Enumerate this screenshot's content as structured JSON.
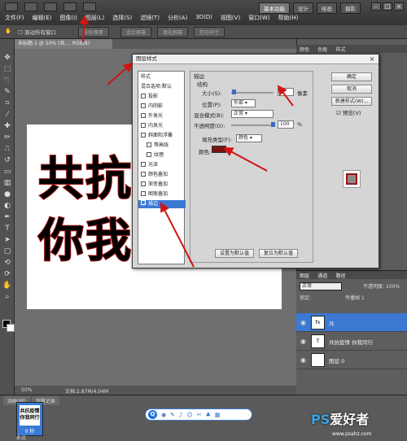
{
  "menubar": {
    "items": [
      "文件(F)",
      "编辑(E)",
      "图像(I)",
      "图层(L)",
      "选择(S)",
      "滤镜(T)",
      "分析(A)",
      "3D(D)",
      "视图(V)",
      "窗口(W)",
      "帮助(H)"
    ],
    "workspaces": [
      "基本功能",
      "设计",
      "绘画",
      "摄影"
    ]
  },
  "optionsbar": {
    "scroll_all": "滚动所有窗口",
    "btn_actual": "实际像素",
    "btn_fit": "适合屏幕",
    "btn_fill": "填充屏幕",
    "btn_print": "打印尺寸"
  },
  "document": {
    "tab": "未标题-1 @ 50% (共..., RGB/8)",
    "line1": "共抗",
    "line2": "你我 行",
    "zoom": "50%",
    "doc_size": "文档:2.87M/4.04M"
  },
  "dialog": {
    "title": "图层样式",
    "styles_header": "样式",
    "blend_options": "混合选项:默认",
    "styles": [
      "投影",
      "内阴影",
      "外发光",
      "内发光",
      "斜面和浮雕",
      "等高线",
      "纹理",
      "光泽",
      "颜色叠加",
      "渐变叠加",
      "图案叠加",
      "描边"
    ],
    "stroke": {
      "section": "描边",
      "structure": "结构",
      "size_label": "大小(S):",
      "size_value": "5",
      "size_unit": "像素",
      "position_label": "位置(P):",
      "position_value": "外部",
      "blend_label": "混合模式(B):",
      "blend_value": "正常",
      "opacity_label": "不透明度(O):",
      "opacity_value": "100",
      "opacity_unit": "%",
      "fill_type_label": "填充类型(F):",
      "fill_type_value": "颜色",
      "color_label": "颜色:",
      "color_hex": "#7a1414"
    },
    "btn_set_default": "设置为默认值",
    "btn_reset_default": "复位为默认值",
    "btn_ok": "确定",
    "btn_cancel": "取消",
    "btn_new_style": "新建样式(W)...",
    "preview_label": "预览(V)"
  },
  "panels": {
    "top_tabs": [
      "颜色",
      "色板",
      "样式"
    ],
    "layers_tabs": [
      "图层",
      "通道",
      "路径"
    ],
    "blend_mode": "正常",
    "opacity": "不透明度: 100%",
    "lock": "锁定:",
    "fill": "填充: 100%",
    "propagate": "传播帧 1",
    "layers": [
      {
        "name": "共",
        "selected": true,
        "thumb": "fx"
      },
      {
        "name": "共抗疫情 你我同行",
        "selected": false,
        "thumb": "T"
      },
      {
        "name": "图层 0",
        "selected": false,
        "thumb": ""
      }
    ]
  },
  "animation": {
    "tabs": [
      "动画(帧)",
      "测量记录"
    ],
    "frame_duration": "0 秒",
    "loop": "永远",
    "frame_thumb": "共抗疫情你我同行"
  },
  "watermark": {
    "brand": "PS",
    "brand_cn": "爱好者",
    "url": "www.psahz.com"
  }
}
